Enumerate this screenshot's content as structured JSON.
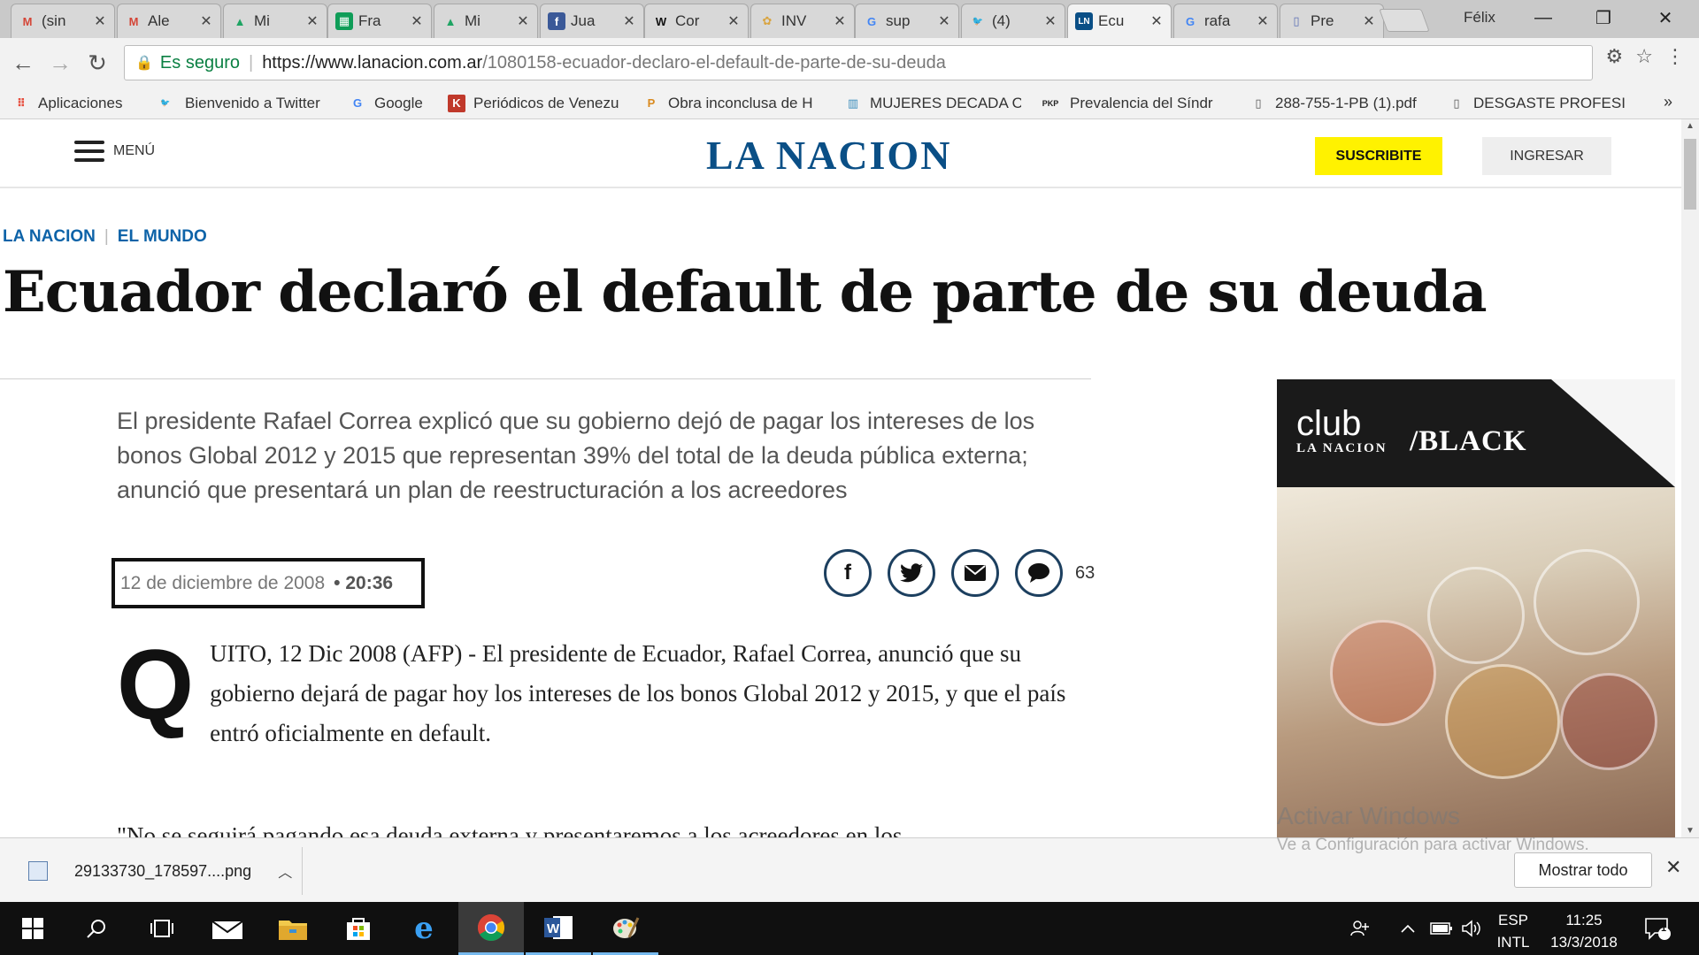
{
  "browser": {
    "tabs": [
      {
        "label": "(sin",
        "icon": "gmail-icon",
        "glyph": "M",
        "color": "#d44638",
        "bg": "transparent"
      },
      {
        "label": "Ale",
        "icon": "gmail-icon",
        "glyph": "M",
        "color": "#d44638",
        "bg": "transparent"
      },
      {
        "label": "Mi",
        "icon": "drive-icon",
        "glyph": "▲",
        "color": "#1fa463",
        "bg": "transparent"
      },
      {
        "label": "Fra",
        "icon": "sheets-icon",
        "glyph": "▦",
        "color": "#ffffff",
        "bg": "#0f9d58"
      },
      {
        "label": "Mi",
        "icon": "drive-icon",
        "glyph": "▲",
        "color": "#1fa463",
        "bg": "transparent"
      },
      {
        "label": "Jua",
        "icon": "facebook-icon",
        "glyph": "f",
        "color": "#ffffff",
        "bg": "#3b5998"
      },
      {
        "label": "Cor",
        "icon": "wikipedia-icon",
        "glyph": "W",
        "color": "#111111",
        "bg": "transparent"
      },
      {
        "label": "INV",
        "icon": "inv-icon",
        "glyph": "✿",
        "color": "#d9a441",
        "bg": "transparent"
      },
      {
        "label": "sup",
        "icon": "google-icon",
        "glyph": "G",
        "color": "#4285f4",
        "bg": "transparent"
      },
      {
        "label": "(4)",
        "icon": "twitter-icon",
        "glyph": "🐦",
        "color": "#1da1f2",
        "bg": "transparent"
      },
      {
        "label": "Ecu",
        "icon": "lanacion-icon",
        "glyph": "LN",
        "color": "#ffffff",
        "bg": "#0a4f86",
        "active": true
      },
      {
        "label": "rafa",
        "icon": "google-icon",
        "glyph": "G",
        "color": "#4285f4",
        "bg": "transparent"
      },
      {
        "label": "Pre",
        "icon": "document-icon",
        "glyph": "▯",
        "color": "#5b6fb5",
        "bg": "transparent"
      }
    ],
    "user": "Félix",
    "url": {
      "secure_label": "Es seguro",
      "host": "https://www.lanacion.com.ar",
      "path": "/1080158-ecuador-declaro-el-default-de-parte-de-su-deuda"
    },
    "bookmarks": [
      {
        "label": "Aplicaciones",
        "icon": "apps-grid-icon",
        "glyph": "⠿",
        "color": "#e74c3c",
        "bg": "transparent"
      },
      {
        "label": "Bienvenido a Twitter",
        "icon": "twitter-icon",
        "glyph": "🐦",
        "color": "#1da1f2",
        "bg": "transparent"
      },
      {
        "label": "Google",
        "icon": "google-icon",
        "glyph": "G",
        "color": "#4285f4",
        "bg": "transparent"
      },
      {
        "label": "Periódicos de Venezu",
        "icon": "kiosko-icon",
        "glyph": "K",
        "color": "#ffffff",
        "bg": "#c0392b"
      },
      {
        "label": "Obra inconclusa de H",
        "icon": "pdf-icon",
        "glyph": "P",
        "color": "#d98a1f",
        "bg": "transparent"
      },
      {
        "label": "MUJERES DECADA O",
        "icon": "building-icon",
        "glyph": "▥",
        "color": "#3c8dbc",
        "bg": "transparent"
      },
      {
        "label": "Prevalencia del Síndr",
        "icon": "pkp-icon",
        "glyph": "PKP",
        "color": "#222222",
        "bg": "transparent"
      },
      {
        "label": "288-755-1-PB (1).pdf",
        "icon": "file-icon",
        "glyph": "▯",
        "color": "#555555",
        "bg": "transparent"
      },
      {
        "label": "DESGASTE PROFESIO",
        "icon": "file-icon",
        "glyph": "▯",
        "color": "#555555",
        "bg": "transparent"
      }
    ]
  },
  "site": {
    "menu_label": "MENÚ",
    "logo": "LA NACION",
    "subscribe_label": "SUSCRIBITE",
    "login_label": "INGRESAR"
  },
  "article": {
    "breadcrumb": [
      "LA NACION",
      "EL MUNDO"
    ],
    "headline": "Ecuador declaró el default de parte de su deuda",
    "lead": "El presidente Rafael Correa explicó que su gobierno dejó de pagar los intereses de los bonos Global 2012 y 2015 que representan 39% del total de la deuda pública externa; anunció que presentará un plan de reestructuración a los acreedores",
    "date": "12 de diciembre de 2008",
    "time": "• 20:36",
    "comment_count": "63",
    "dropcap": "Q",
    "first_paragraph": "UITO, 12 Dic 2008 (AFP) - El presidente de Ecuador, Rafael Correa, anunció que su gobierno dejará de pagar hoy los intereses de los bonos Global 2012 y 2015, y que el país entró oficialmente en default.",
    "second_paragraph": "\"No se seguirá pagando esa deuda externa y presentaremos a los acreedores en los"
  },
  "ad": {
    "club": "club",
    "brand": "LA NACION",
    "black": "/BLACK"
  },
  "watermark": {
    "line1": "Activar Windows",
    "line2": "Ve a Configuración para activar Windows."
  },
  "downloads": {
    "file": "29133730_178597....png",
    "show_all": "Mostrar todo"
  },
  "taskbar": {
    "lang_top": "ESP",
    "lang_bottom": "INTL",
    "time": "11:25",
    "date": "13/3/2018",
    "notifications": "1"
  }
}
